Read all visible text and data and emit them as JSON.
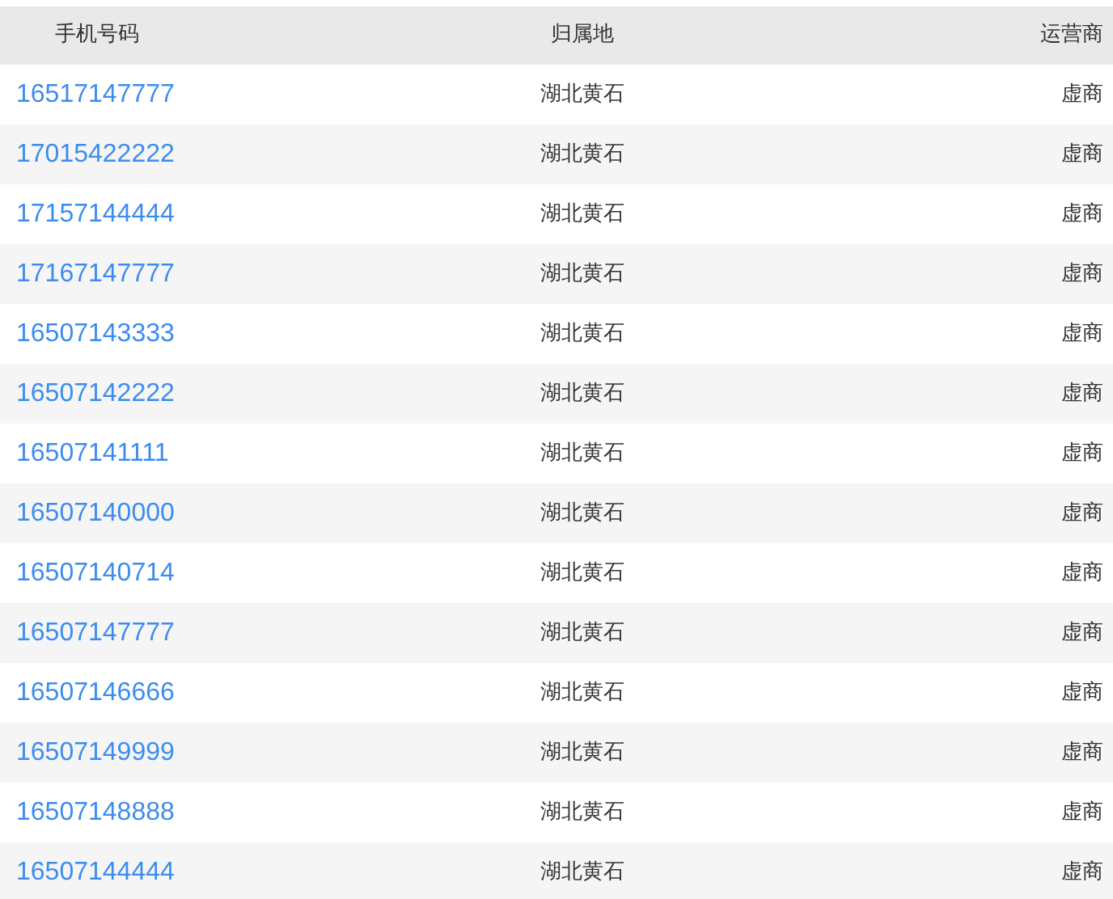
{
  "table": {
    "columns": [
      "手机号码",
      "归属地",
      "运营商"
    ],
    "rows": [
      {
        "number": "16517147777",
        "location": "湖北黄石",
        "carrier": "虚商"
      },
      {
        "number": "17015422222",
        "location": "湖北黄石",
        "carrier": "虚商"
      },
      {
        "number": "17157144444",
        "location": "湖北黄石",
        "carrier": "虚商"
      },
      {
        "number": "17167147777",
        "location": "湖北黄石",
        "carrier": "虚商"
      },
      {
        "number": "16507143333",
        "location": "湖北黄石",
        "carrier": "虚商"
      },
      {
        "number": "16507142222",
        "location": "湖北黄石",
        "carrier": "虚商"
      },
      {
        "number": "16507141111",
        "location": "湖北黄石",
        "carrier": "虚商"
      },
      {
        "number": "16507140000",
        "location": "湖北黄石",
        "carrier": "虚商"
      },
      {
        "number": "16507140714",
        "location": "湖北黄石",
        "carrier": "虚商"
      },
      {
        "number": "16507147777",
        "location": "湖北黄石",
        "carrier": "虚商"
      },
      {
        "number": "16507146666",
        "location": "湖北黄石",
        "carrier": "虚商"
      },
      {
        "number": "16507149999",
        "location": "湖北黄石",
        "carrier": "虚商"
      },
      {
        "number": "16507148888",
        "location": "湖北黄石",
        "carrier": "虚商"
      },
      {
        "number": "16507144444",
        "location": "湖北黄石",
        "carrier": "虚商"
      }
    ]
  }
}
